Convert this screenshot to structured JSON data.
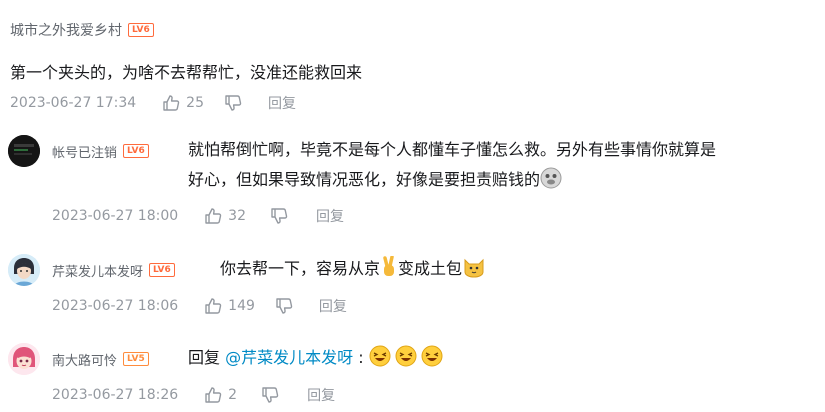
{
  "comment": {
    "username": "城市之外我爱乡村",
    "level": "LV6",
    "content": "第一个夹头的，为啥不去帮帮忙，没准还能救回来",
    "time": "2023-06-27 17:34",
    "likes": "25",
    "reply_label": "回复"
  },
  "replies": [
    {
      "username": "帐号已注销",
      "level": "LV6",
      "content_line1": "就怕帮倒忙啊，毕竟不是每个人都懂车子懂怎么救。另外有些事情你就算是",
      "content_line2": "好心，但如果导致情况恶化，好像是要担责赔钱的",
      "emoji": "doge-face-icon",
      "time": "2023-06-27 18:00",
      "likes": "32",
      "reply_label": "回复"
    },
    {
      "username": "芹菜发儿本发呀",
      "level": "LV6",
      "content_a": "你去帮一下，容易从京",
      "content_b": "变成土包",
      "emoji_1": "victory-hand-icon",
      "emoji_2": "cat-face-icon",
      "time": "2023-06-27 18:06",
      "likes": "149",
      "reply_label": "回复"
    },
    {
      "username": "南大路可怜",
      "level": "LV5",
      "content_prefix": "回复 ",
      "mention": "@芹菜发儿本发呀",
      "content_suffix": " :",
      "emojis": [
        "laughing-face-icon",
        "laughing-face-icon",
        "laughing-face-icon"
      ],
      "time": "2023-06-27 18:26",
      "likes": "2",
      "reply_label": "回复"
    }
  ],
  "colors": {
    "level_badge": "#ff6b3d",
    "meta_text": "#9499a0",
    "username": "#61666d",
    "mention": "#008ac5"
  }
}
